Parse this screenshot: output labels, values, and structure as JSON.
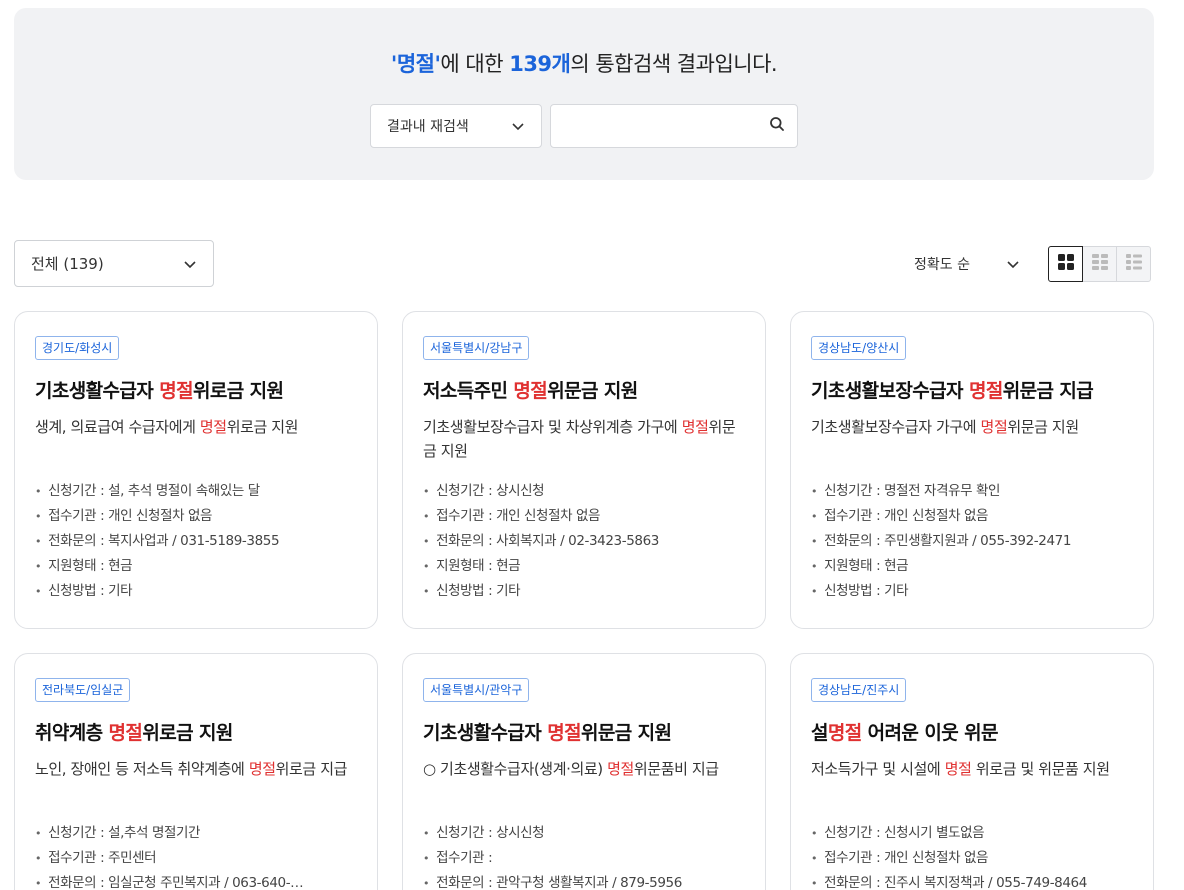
{
  "search": {
    "keyword": "'명절'",
    "text_after_keyword": "에 대한 ",
    "count": "139개",
    "text_after_count": "의 통합검색 결과입니다.",
    "scope_select": "결과내 재검색",
    "input_value": "",
    "input_placeholder": ""
  },
  "filter": {
    "category_select": "전체 (139)",
    "sort_select": "정확도 순"
  },
  "view_modes": [
    "grid-large-icon",
    "grid-small-icon",
    "list-icon"
  ],
  "cards": [
    {
      "region": "경기도/화성시",
      "title": [
        {
          "t": "기초생활수급자 "
        },
        {
          "t": "명절",
          "hl": true
        },
        {
          "t": "위로금 지원"
        }
      ],
      "desc": [
        {
          "t": "생계, 의료급여 수급자에게 "
        },
        {
          "t": "명절",
          "hl": true
        },
        {
          "t": "위로금 지원"
        }
      ],
      "info": [
        "신청기간 : 설, 추석 명절이 속해있는 달",
        "접수기관 : 개인 신청절차 없음",
        "전화문의 : 복지사업과 / 031-5189-3855",
        "지원형태 : 현금",
        "신청방법 : 기타"
      ]
    },
    {
      "region": "서울특별시/강남구",
      "title": [
        {
          "t": "저소득주민 "
        },
        {
          "t": "명절",
          "hl": true
        },
        {
          "t": "위문금 지원"
        }
      ],
      "desc": [
        {
          "t": "기초생활보장수급자 및 차상위계층 가구에 "
        },
        {
          "t": "명절",
          "hl": true
        },
        {
          "t": "위문금 지원"
        }
      ],
      "info": [
        "신청기간 : 상시신청",
        "접수기관 : 개인 신청절차 없음",
        "전화문의 : 사회복지과 / 02-3423-5863",
        "지원형태 : 현금",
        "신청방법 : 기타"
      ]
    },
    {
      "region": "경상남도/양산시",
      "title": [
        {
          "t": "기초생활보장수급자 "
        },
        {
          "t": "명절",
          "hl": true
        },
        {
          "t": "위문금 지급"
        }
      ],
      "desc": [
        {
          "t": "기초생활보장수급자 가구에 "
        },
        {
          "t": "명절",
          "hl": true
        },
        {
          "t": "위문금 지원"
        }
      ],
      "info": [
        "신청기간 : 명절전 자격유무 확인",
        "접수기관 : 개인 신청절차 없음",
        "전화문의 : 주민생활지원과 / 055-392-2471",
        "지원형태 : 현금",
        "신청방법 : 기타"
      ]
    },
    {
      "region": "전라북도/임실군",
      "title": [
        {
          "t": "취약계층 "
        },
        {
          "t": "명절",
          "hl": true
        },
        {
          "t": "위로금 지원"
        }
      ],
      "desc": [
        {
          "t": "노인, 장애인 등 저소득 취약계층에 "
        },
        {
          "t": "명절",
          "hl": true
        },
        {
          "t": "위로금 지급"
        }
      ],
      "info": [
        "신청기간 : 설,추석 명절기간",
        "접수기관 : 주민센터",
        "전화문의 : 임실군청 주민복지과 / 063-640-…"
      ]
    },
    {
      "region": "서울특별시/관악구",
      "title": [
        {
          "t": "기초생활수급자 "
        },
        {
          "t": "명절",
          "hl": true
        },
        {
          "t": "위문금 지원"
        }
      ],
      "desc": [
        {
          "t": "○ 기초생활수급자(생계·의료) "
        },
        {
          "t": "명절",
          "hl": true
        },
        {
          "t": "위문품비 지급"
        }
      ],
      "info": [
        "신청기간 : 상시신청",
        "접수기관 :",
        "전화문의 : 관악구청 생활복지과 / 879-5956"
      ]
    },
    {
      "region": "경상남도/진주시",
      "title": [
        {
          "t": "설"
        },
        {
          "t": "명절",
          "hl": true
        },
        {
          "t": " 어려운 이웃 위문"
        }
      ],
      "desc": [
        {
          "t": "저소득가구 및 시설에 "
        },
        {
          "t": "명절",
          "hl": true
        },
        {
          "t": " 위로금 및 위문품 지원"
        }
      ],
      "info": [
        "신청기간 : 신청시기 별도없음",
        "접수기관 : 개인 신청절차 없음",
        "전화문의 : 진주시 복지정책과 / 055-749-8464"
      ]
    }
  ]
}
